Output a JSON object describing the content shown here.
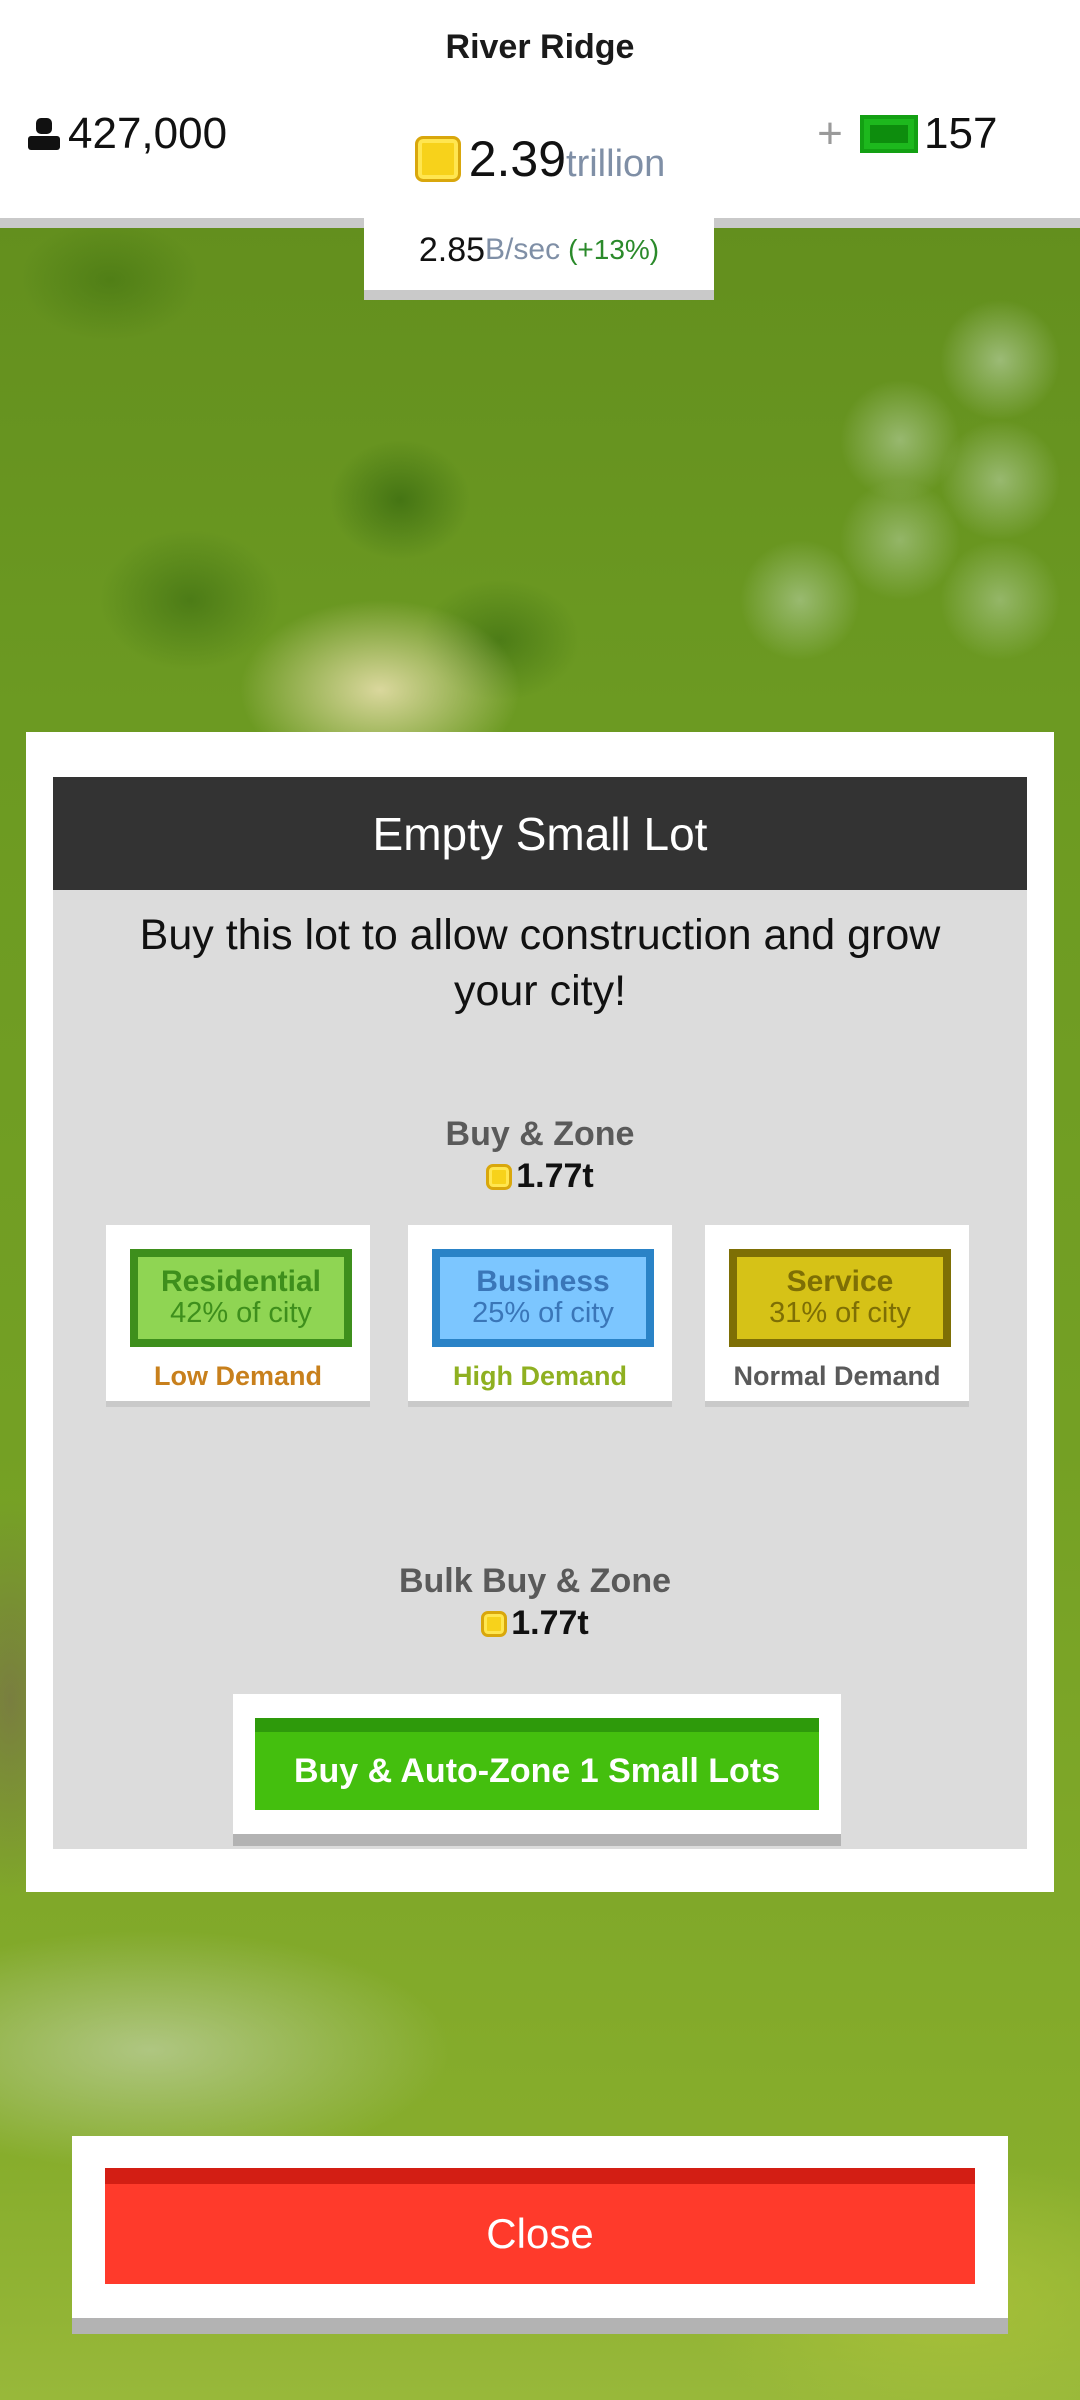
{
  "header": {
    "city_name": "River Ridge",
    "population": "427,000",
    "coins_amount": "2.39",
    "coins_unit": "trillion",
    "rate_value": "2.85",
    "rate_unit": "B/sec",
    "rate_change": "(+13%)",
    "plus_label": "+",
    "cash": "157"
  },
  "modal": {
    "title": "Empty Small Lot",
    "description": "Buy this lot to allow construction and grow your city!",
    "buy_zone": {
      "title": "Buy & Zone",
      "price": "1.77t"
    },
    "zones": [
      {
        "name": "Residential",
        "share": "42% of city",
        "demand": "Low Demand"
      },
      {
        "name": "Business",
        "share": "25% of city",
        "demand": "High Demand"
      },
      {
        "name": "Service",
        "share": "31% of city",
        "demand": "Normal Demand"
      }
    ],
    "bulk": {
      "title": "Bulk Buy & Zone",
      "price": "1.77t",
      "button_label": "Buy & Auto-Zone 1 Small Lots"
    }
  },
  "close_label": "Close",
  "icons": {
    "population": "person-icon",
    "coins": "coin-icon",
    "cash": "cash-icon"
  },
  "colors": {
    "residential": "#8fd553",
    "business": "#7cc6ff",
    "service": "#d6c217",
    "low_demand": "#c8801c",
    "high_demand": "#8fb021",
    "normal_demand": "#5a5a5a",
    "bulk_button": "#44bf0e",
    "close_button": "#ff3a2b"
  }
}
